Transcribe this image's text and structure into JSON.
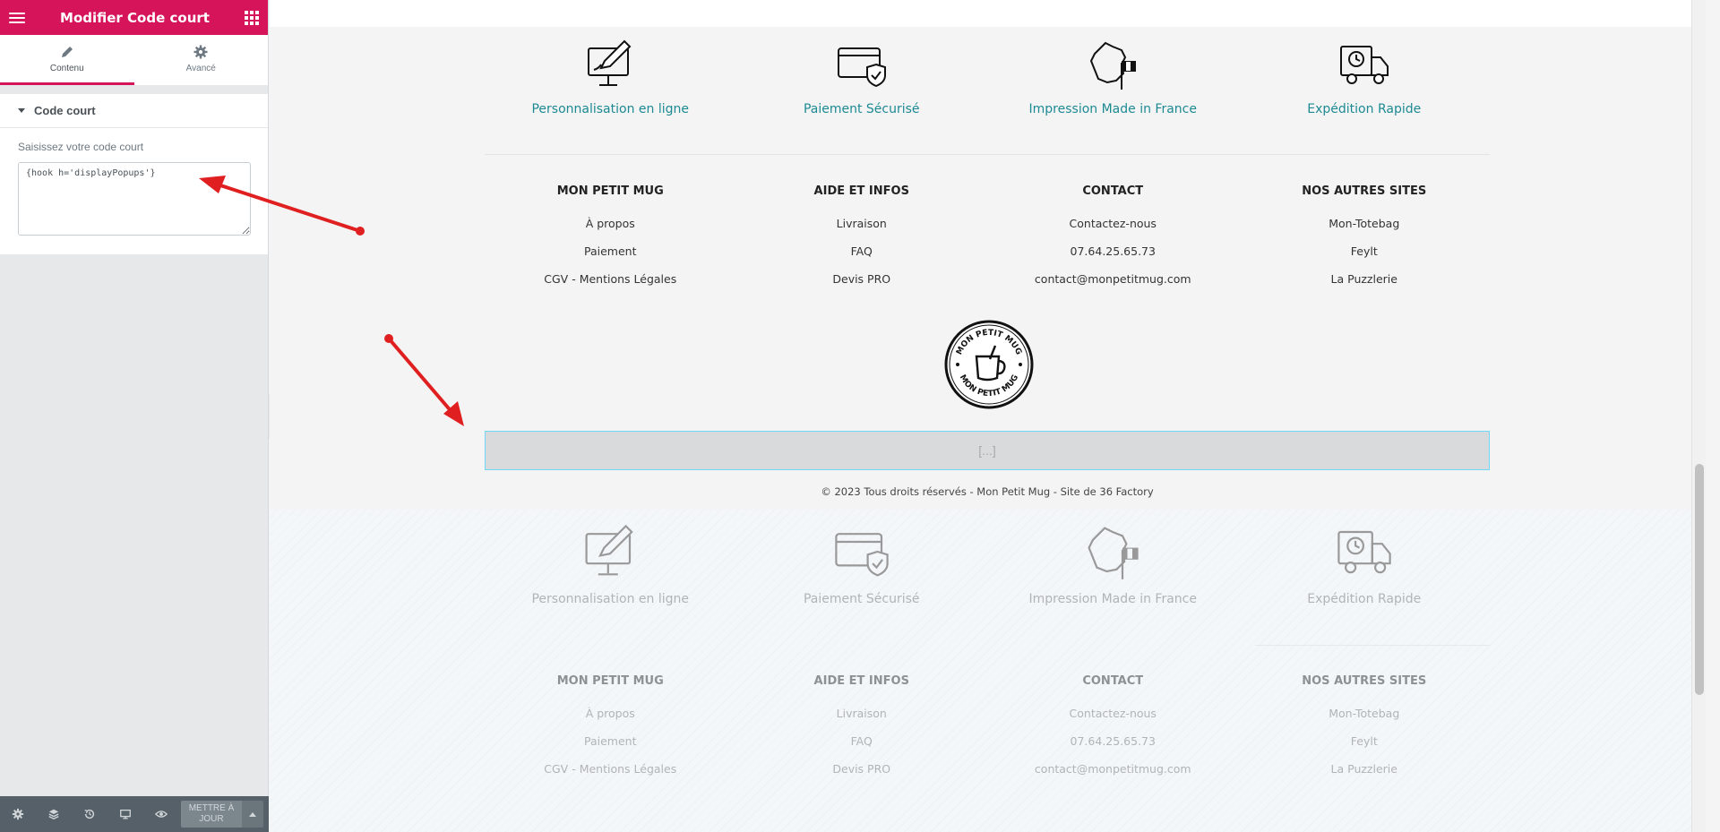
{
  "editor": {
    "title": "Modifier Code court",
    "tabs": [
      {
        "label": "Contenu",
        "icon": "pencil-icon",
        "active": true
      },
      {
        "label": "Avancé",
        "icon": "gear-icon",
        "active": false
      }
    ],
    "section_title": "Code court",
    "field_label": "Saisissez votre code court",
    "field_value": "{hook h='displayPopups'}",
    "footer": {
      "update_label": "METTRE À JOUR",
      "icons": [
        "settings-icon",
        "layers-icon",
        "history-icon",
        "responsive-icon",
        "preview-eye-icon"
      ]
    }
  },
  "features": [
    {
      "label": "Personnalisation en ligne",
      "icon": "design-monitor-icon"
    },
    {
      "label": "Paiement Sécurisé",
      "icon": "secure-card-icon"
    },
    {
      "label": "Impression Made in France",
      "icon": "france-map-flag-icon"
    },
    {
      "label": "Expédition Rapide",
      "icon": "delivery-truck-icon"
    }
  ],
  "columns": [
    {
      "heading": "MON PETIT MUG",
      "links": [
        "À propos",
        "Paiement",
        "CGV - Mentions Légales"
      ]
    },
    {
      "heading": "AIDE ET INFOS",
      "links": [
        "Livraison",
        "FAQ",
        "Devis PRO"
      ]
    },
    {
      "heading": "CONTACT",
      "links": [
        "Contactez-nous",
        "07.64.25.65.73",
        "contact@monpetitmug.com"
      ]
    },
    {
      "heading": "NOS AUTRES SITES",
      "links": [
        "Mon-Totebag",
        "Feylt",
        "La Puzzlerie"
      ]
    }
  ],
  "logo_text": "MON PETIT MUG",
  "shortcode_placeholder": "[...]",
  "copyright": "© 2023 Tous droits réservés - Mon Petit Mug - Site de 36 Factory",
  "colors": {
    "brand": "#d5145a",
    "feature_text": "#1d8a93",
    "annotation": "#e02020"
  }
}
